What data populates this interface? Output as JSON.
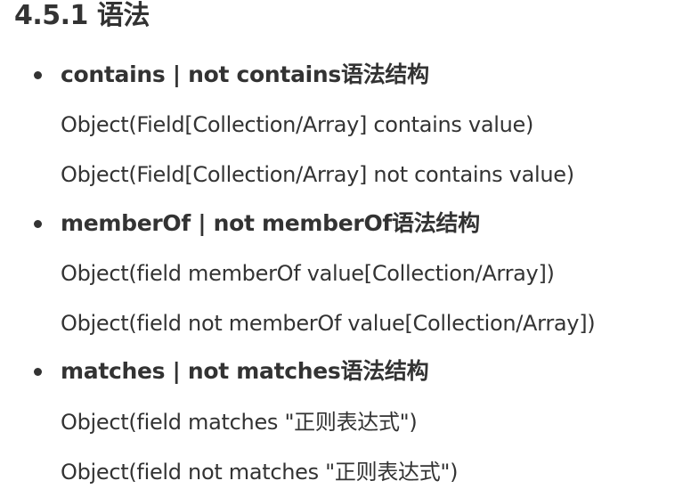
{
  "heading": "4.5.1 语法",
  "items": [
    {
      "title": "contains | not contains语法结构",
      "lines": [
        "Object(Field[Collection/Array] contains value)",
        "Object(Field[Collection/Array] not contains value)"
      ]
    },
    {
      "title": "memberOf | not memberOf语法结构",
      "lines": [
        "Object(field memberOf value[Collection/Array])",
        "Object(field not memberOf value[Collection/Array])"
      ]
    },
    {
      "title": "matches | not matches语法结构",
      "lines": [
        "Object(field matches \"正则表达式\")",
        "Object(field not matches \"正则表达式\")"
      ]
    }
  ]
}
